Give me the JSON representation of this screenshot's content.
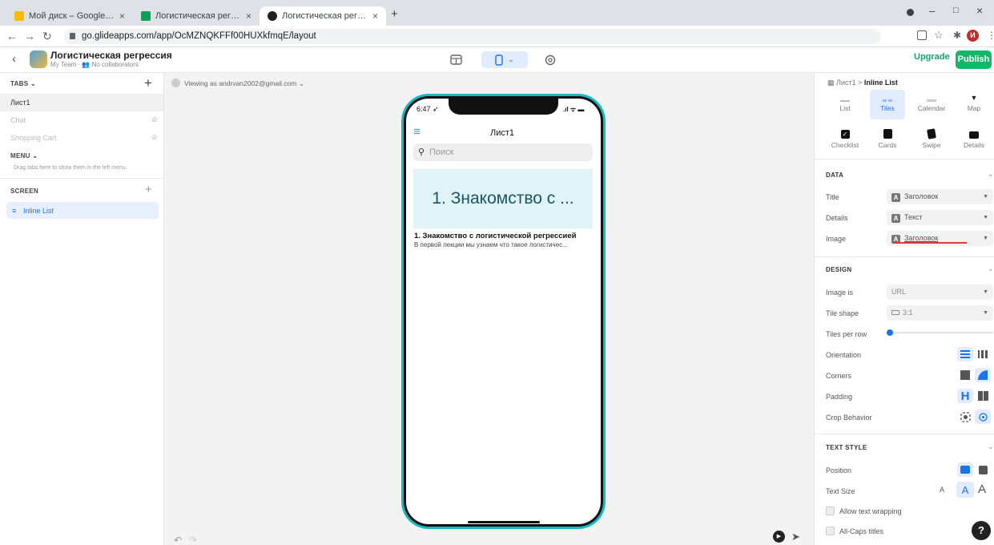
{
  "browser": {
    "tabs": [
      {
        "title": "Мой диск – Google Диск",
        "color": "#fbbc04"
      },
      {
        "title": "Логистическая регрессия - Goo",
        "color": "#0f9d58"
      },
      {
        "title": "Логистическая регрессия · Glid",
        "color": "#202124"
      }
    ],
    "new_tab": "+",
    "url": "go.glideapps.com/app/OcMZNQKFFf00HUXkfmqE/layout",
    "window_controls": [
      "–",
      "□",
      "×"
    ]
  },
  "header": {
    "app_name": "Логистическая регрессия",
    "app_subtitle": "My Team · 👥 No collaborators",
    "upgrade": "Upgrade",
    "publish": "Publish"
  },
  "left": {
    "tabs_label": "TABS",
    "tab_items": [
      {
        "label": "Лист1",
        "active": true
      },
      {
        "label": "Chat",
        "active": false
      },
      {
        "label": "Shopping Cart",
        "active": false
      }
    ],
    "menu_label": "MENU",
    "menu_hint": "Drag tabs here to show them in the left menu.",
    "screen_label": "SCREEN",
    "screen_item": "Inline List"
  },
  "canvas": {
    "viewing_as": "Viewing as andrvan2002@gmail.com"
  },
  "phone": {
    "time": "6:47",
    "screen_title": "Лист1",
    "search_placeholder": "Поиск",
    "tile_title": "1. Знакомство с ...",
    "item_title": "1. Знакомство с логистической регрессией",
    "item_desc": "В первой лекции мы узнаем что такое логистичес..."
  },
  "right": {
    "breadcrumb_parent": "Лист1",
    "breadcrumb_sep": ">",
    "breadcrumb_current": "Inline List",
    "styles_row1": [
      "List",
      "Tiles",
      "Calendar",
      "Map"
    ],
    "styles_row2": [
      "Checklist",
      "Cards",
      "Swipe",
      "Details"
    ],
    "selected_style": "Tiles",
    "data_label": "DATA",
    "data_rows": [
      {
        "label": "Title",
        "value": "Заголовок"
      },
      {
        "label": "Details",
        "value": "Текст"
      },
      {
        "label": "Image",
        "value": "Заголовок"
      }
    ],
    "design_label": "DESIGN",
    "image_is_label": "Image is",
    "image_is_value": "URL",
    "tile_shape_label": "Tile shape",
    "tile_shape_value": "3:1",
    "tiles_per_row_label": "Tiles per row",
    "tiles_per_row_value": 1,
    "orientation_label": "Orientation",
    "corners_label": "Corners",
    "padding_label": "Padding",
    "crop_label": "Crop Behavior",
    "text_style_label": "TEXT STYLE",
    "position_label": "Position",
    "text_size_label": "Text Size",
    "text_size_options": [
      "A",
      "A",
      "A"
    ],
    "wrap_label": "Allow text wrapping",
    "caps_label": "All-Caps titles",
    "help": "?"
  },
  "colors": {
    "accent": "#1a73e8",
    "publish": "#12b76a",
    "phone_frame": "#1ab7c5",
    "tile_bg": "#e0f4f7",
    "tile_text": "#1a5561",
    "underline": "#e53935"
  }
}
